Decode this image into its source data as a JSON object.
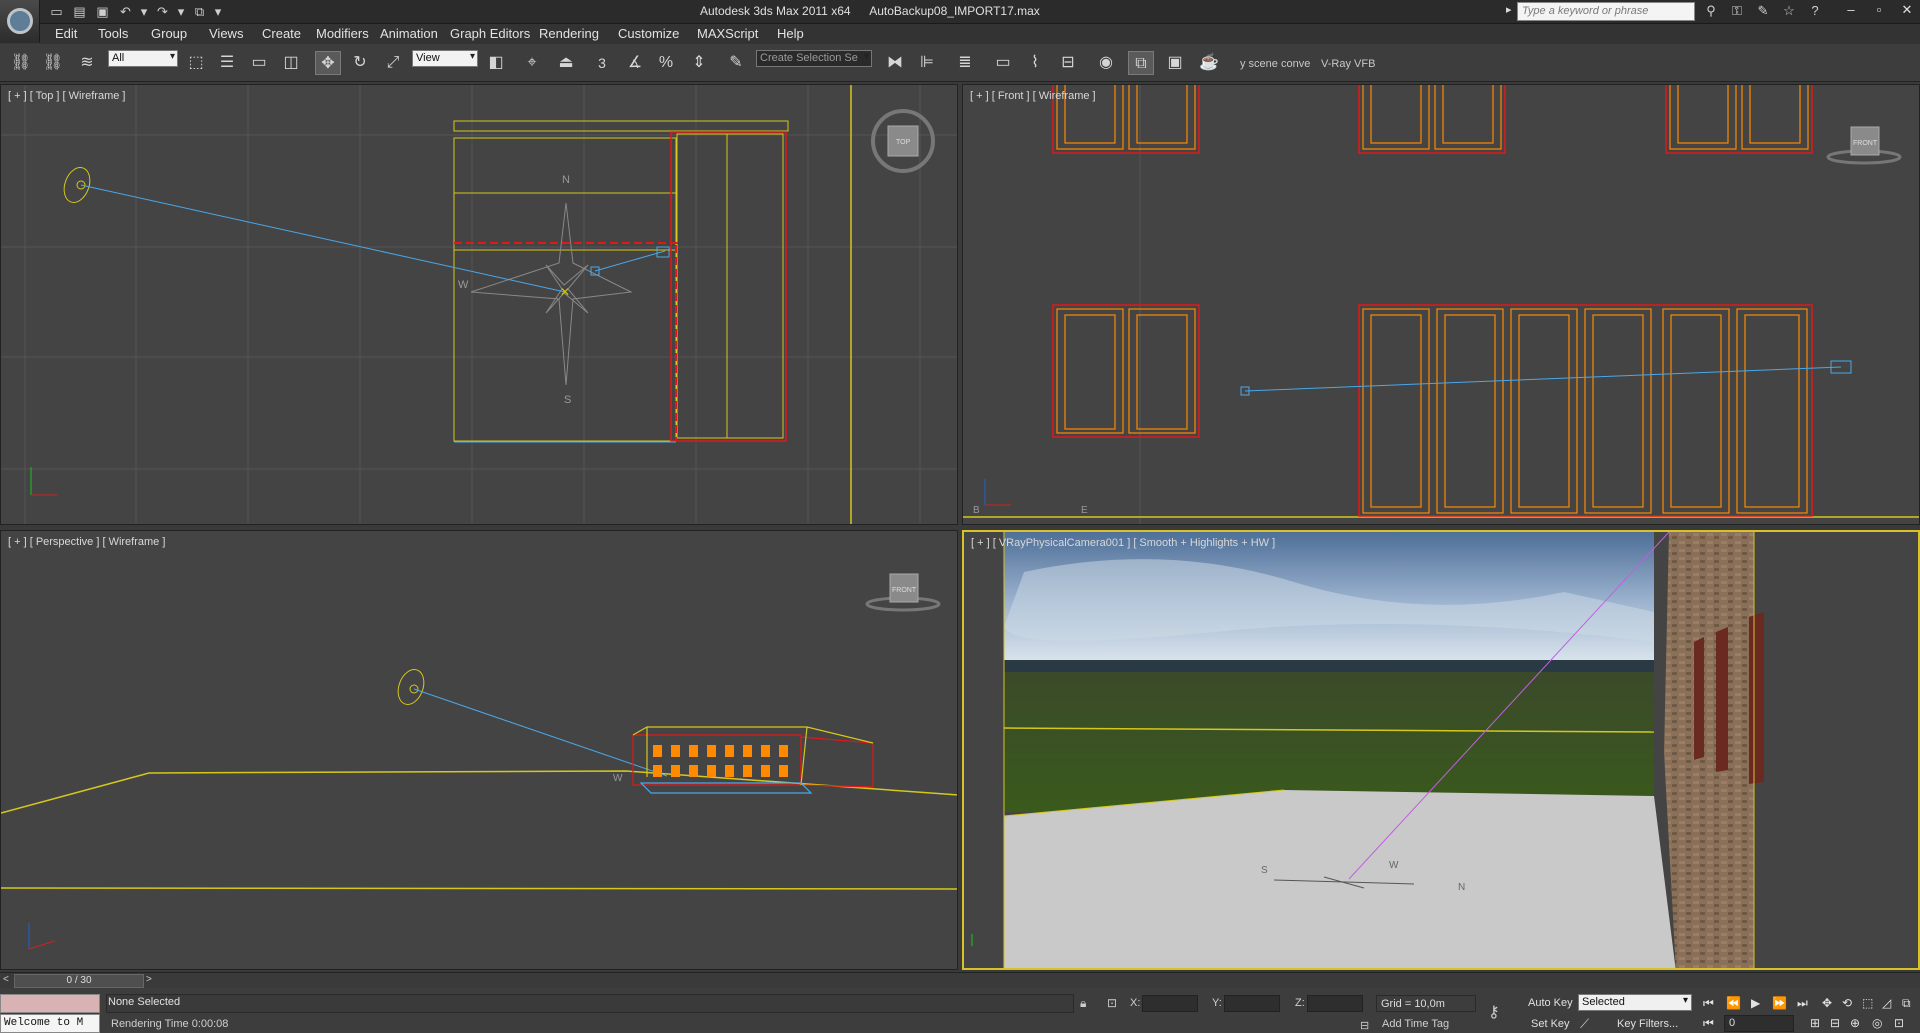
{
  "window": {
    "app_title": "Autodesk 3ds Max  2011 x64",
    "file_title": "AutoBackup08_IMPORT17.max",
    "search_placeholder": "Type a keyword or phrase"
  },
  "menu": [
    "Edit",
    "Tools",
    "Group",
    "Views",
    "Create",
    "Modifiers",
    "Animation",
    "Graph Editors",
    "Rendering",
    "Customize",
    "MAXScript",
    "Help"
  ],
  "toolbar": {
    "selection_filter": "All",
    "reference_coord": "View",
    "named_selection": "Create Selection Se",
    "snap_label": "3",
    "scene_converter": "y scene conve",
    "vray_vfb": "V-Ray VFB"
  },
  "viewports": {
    "top": {
      "label": "[ + ] [ Top ] [ Wireframe ]",
      "viewcube": "TOP",
      "compass": [
        "N",
        "S",
        "W"
      ]
    },
    "front": {
      "label": "[ + ] [ Front ] [ Wireframe ]",
      "viewcube": "FRONT",
      "axis_labels": [
        "B",
        "E"
      ]
    },
    "perspective": {
      "label": "[ + ] [ Perspective ] [ Wireframe ]",
      "viewcube": "FRONT",
      "compass": [
        "W"
      ]
    },
    "camera": {
      "label": "[ + ] [ VRayPhysicalCamera001 ] [ Smooth + Highlights + HW ]",
      "compass": [
        "S",
        "W",
        "N"
      ]
    }
  },
  "timeslider": {
    "frame_display": "0 / 30",
    "prev": "<",
    "next": ">"
  },
  "status": {
    "selection": "None Selected",
    "render_time": "Rendering Time  0:00:08",
    "listener": "Welcome to M",
    "x_label": "X:",
    "y_label": "Y:",
    "z_label": "Z:",
    "grid": "Grid = 10,0m",
    "add_time_tag": "Add Time Tag",
    "auto_key": "Auto Key",
    "set_key": "Set Key",
    "key_mode": "Selected",
    "key_filters": "Key Filters...",
    "current_frame": "0"
  },
  "colors": {
    "background": "#3a3a3a",
    "viewport": "#444444",
    "wire_yellow": "#d4c81c",
    "wire_red": "#e01818",
    "wire_orange": "#ff8a00",
    "light_blue": "#4aa8e8",
    "active_border": "#d8c22a"
  }
}
